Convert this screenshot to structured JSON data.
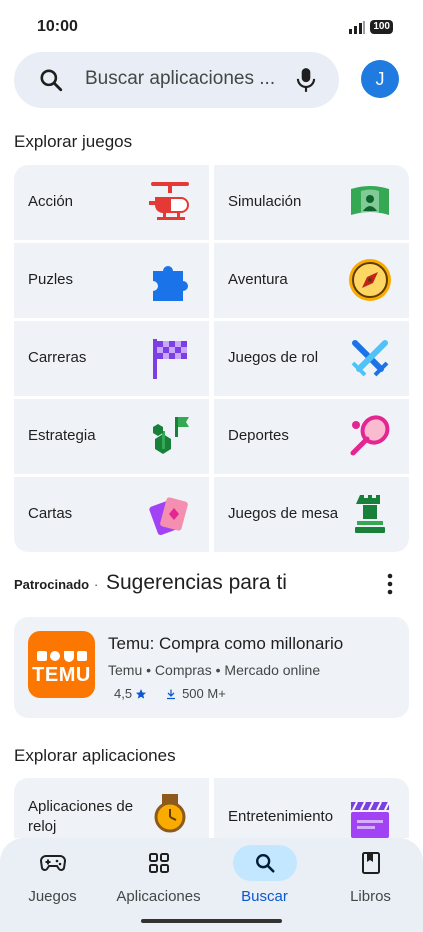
{
  "status": {
    "time": "10:00",
    "battery": "100"
  },
  "search": {
    "placeholder": "Buscar aplicaciones ...",
    "avatar_letter": "J"
  },
  "games_section": {
    "title": "Explorar juegos"
  },
  "game_categories": [
    {
      "label": "Acción",
      "icon": "helicopter-icon"
    },
    {
      "label": "Simulación",
      "icon": "simulation-icon"
    },
    {
      "label": "Puzles",
      "icon": "puzzle-icon"
    },
    {
      "label": "Aventura",
      "icon": "compass-icon"
    },
    {
      "label": "Carreras",
      "icon": "checkered-flag-icon"
    },
    {
      "label": "Juegos de rol",
      "icon": "crossed-swords-icon"
    },
    {
      "label": "Estrategia",
      "icon": "strategy-flag-icon"
    },
    {
      "label": "Deportes",
      "icon": "tennis-racket-icon"
    },
    {
      "label": "Cartas",
      "icon": "cards-icon"
    },
    {
      "label": "Juegos de mesa",
      "icon": "chess-piece-icon"
    }
  ],
  "suggestions": {
    "sponsored": "Patrocinado",
    "separator": "·",
    "title": "Sugerencias para ti",
    "app": {
      "name": "Temu: Compra como millonario",
      "developer": "Temu",
      "category": "Compras",
      "tag": "Mercado online",
      "rating": "4,5",
      "downloads": "500 M+",
      "logo_text": "TEMU",
      "logo_color": "#fb7701"
    }
  },
  "apps_section": {
    "title": "Explorar aplicaciones",
    "categories": [
      {
        "label": "Aplicaciones de reloj",
        "icon": "watch-icon"
      },
      {
        "label": "Entretenimiento",
        "icon": "clapperboard-icon"
      }
    ]
  },
  "bottom_nav": [
    {
      "label": "Juegos",
      "icon": "gamepad-icon",
      "active": false
    },
    {
      "label": "Aplicaciones",
      "icon": "apps-grid-icon",
      "active": false
    },
    {
      "label": "Buscar",
      "icon": "search-icon",
      "active": true
    },
    {
      "label": "Libros",
      "icon": "book-icon",
      "active": false
    }
  ],
  "colors": {
    "accent": "#0b57d0",
    "active_pill": "#c2e7ff",
    "tile_bg": "#eff3f8"
  }
}
